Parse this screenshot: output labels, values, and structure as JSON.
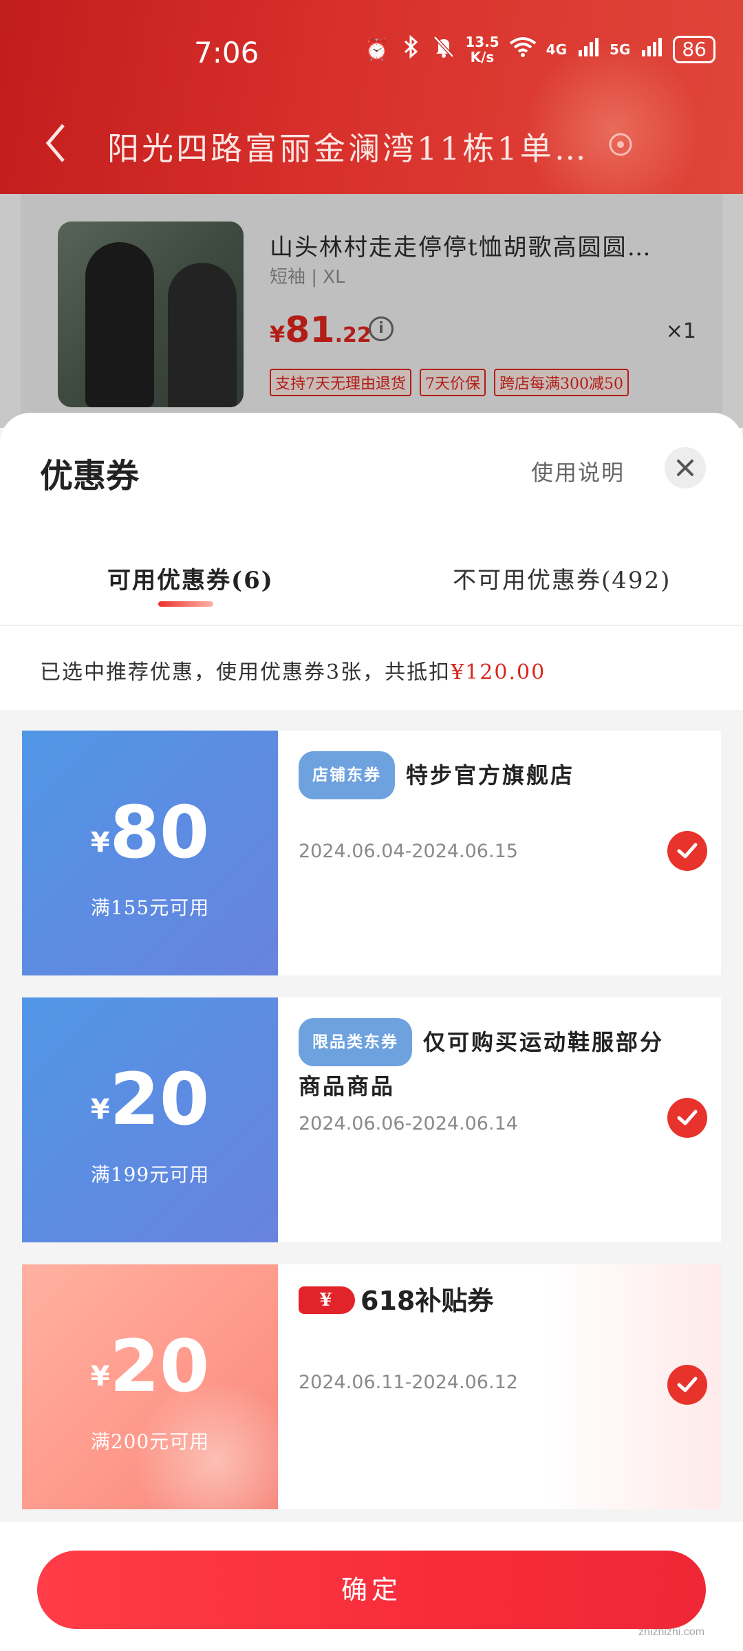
{
  "status_bar": {
    "time": "7:06",
    "speed_value": "13.5",
    "speed_unit": "K/s",
    "net1": "4G",
    "net2": "5G",
    "battery": "86"
  },
  "header": {
    "address": "阳光四路富丽金澜湾11栋1单…"
  },
  "product": {
    "title": "山头林村走走停停t恤胡歌高圆圆…",
    "spec": "短袖 | XL",
    "price_currency": "¥",
    "price_integer": "81",
    "price_decimal": ".22",
    "quantity": "×1",
    "tags": [
      "支持7天无理由退货",
      "7天价保",
      "跨店每满300减50"
    ]
  },
  "sheet": {
    "title": "优惠券",
    "usage_link": "使用说明",
    "tabs": [
      {
        "label": "可用优惠券(6)"
      },
      {
        "label": "不可用优惠券(492)"
      }
    ],
    "summary_text": "已选中推荐优惠，使用优惠券3张，共抵扣",
    "summary_amount": "¥120.00"
  },
  "coupons": [
    {
      "currency": "¥",
      "amount": "80",
      "threshold": "满155元可用",
      "type_label": "店铺东券",
      "title": "特步官方旗舰店",
      "date": "2024.06.04-2024.06.15",
      "selected": true
    },
    {
      "currency": "¥",
      "amount": "20",
      "threshold": "满199元可用",
      "type_label": "限品类东券",
      "title": "仅可购买运动鞋服部分商品商品",
      "date": "2024.06.06-2024.06.14",
      "selected": true
    },
    {
      "currency": "¥",
      "amount": "20",
      "threshold": "满200元可用",
      "badge": "¥",
      "title": "618补贴券",
      "date": "2024.06.11-2024.06.12",
      "selected": true
    }
  ],
  "footer": {
    "confirm_label": "确定"
  },
  "watermark": "zhizhizhi.com",
  "colors": {
    "accent_red": "#e8322c",
    "coupon_blue": "#5196e6",
    "coupon_pink": "#ff9c8e"
  },
  "icons": [
    "alarm-icon",
    "bluetooth-icon",
    "mute-icon",
    "wifi-icon",
    "signal-icon",
    "back-icon",
    "location-pin-icon",
    "info-icon",
    "close-icon",
    "check-icon"
  ]
}
